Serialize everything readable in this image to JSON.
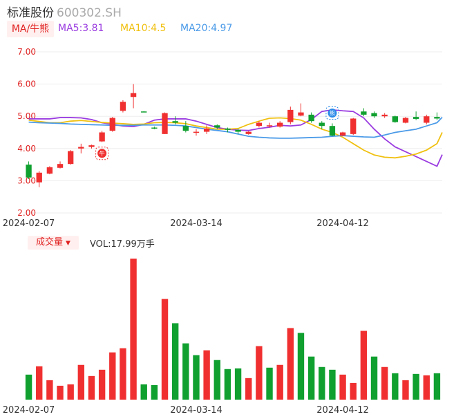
{
  "header": {
    "name": "标准股份",
    "code": "600302.SH"
  },
  "ma_legend": {
    "tag": "MA/牛熊",
    "ma5": "MA5:3.81",
    "ma10": "MA10:4.5",
    "ma20": "MA20:4.97",
    "colors": {
      "ma5": "#9a3be0",
      "ma10": "#f0c010",
      "ma20": "#4a9ae8"
    }
  },
  "volume_legend": {
    "tag": "成交量",
    "value": "VOL:17.99万手"
  },
  "markers": {
    "bull": "牛",
    "bear": "熊"
  },
  "colors": {
    "up": "#f03030",
    "down": "#10a030",
    "grid": "#eeeeee"
  },
  "chart_data": [
    {
      "type": "candlestick",
      "ylim": [
        2.0,
        7.0
      ],
      "yticks": [
        "7.00",
        "6.00",
        "5.00",
        "4.00",
        "3.00",
        "2.00"
      ],
      "xtick_labels": [
        {
          "index": 0,
          "label": "2024-02-07"
        },
        {
          "index": 16,
          "label": "2024-03-14"
        },
        {
          "index": 30,
          "label": "2024-04-12"
        }
      ],
      "candles": [
        {
          "o": 3.5,
          "c": 3.1,
          "h": 3.6,
          "l": 3.05
        },
        {
          "o": 2.95,
          "c": 3.25,
          "h": 3.3,
          "l": 2.8
        },
        {
          "o": 3.22,
          "c": 3.42,
          "h": 3.45,
          "l": 3.2
        },
        {
          "o": 3.4,
          "c": 3.52,
          "h": 3.6,
          "l": 3.38
        },
        {
          "o": 3.52,
          "c": 3.92,
          "h": 3.95,
          "l": 3.5
        },
        {
          "o": 4.0,
          "c": 4.05,
          "h": 4.15,
          "l": 3.85
        },
        {
          "o": 4.05,
          "c": 4.1,
          "h": 4.12,
          "l": 4.0
        },
        {
          "o": 4.22,
          "c": 4.5,
          "h": 4.55,
          "l": 4.2
        },
        {
          "o": 4.55,
          "c": 4.95,
          "h": 4.98,
          "l": 4.52
        },
        {
          "o": 5.17,
          "c": 5.45,
          "h": 5.5,
          "l": 5.12
        },
        {
          "o": 5.6,
          "c": 5.72,
          "h": 6.0,
          "l": 5.25
        },
        {
          "o": 5.15,
          "c": 5.14,
          "h": 5.16,
          "l": 5.13
        },
        {
          "o": 4.65,
          "c": 4.62,
          "h": 4.68,
          "l": 4.6
        },
        {
          "o": 4.45,
          "c": 5.1,
          "h": 5.12,
          "l": 4.45
        },
        {
          "o": 4.85,
          "c": 4.8,
          "h": 5.0,
          "l": 4.75
        },
        {
          "o": 4.7,
          "c": 4.55,
          "h": 4.85,
          "l": 4.5
        },
        {
          "o": 4.52,
          "c": 4.52,
          "h": 4.6,
          "l": 4.4
        },
        {
          "o": 4.52,
          "c": 4.62,
          "h": 4.72,
          "l": 4.45
        },
        {
          "o": 4.72,
          "c": 4.65,
          "h": 4.75,
          "l": 4.6
        },
        {
          "o": 4.62,
          "c": 4.58,
          "h": 4.65,
          "l": 4.5
        },
        {
          "o": 4.58,
          "c": 4.52,
          "h": 4.62,
          "l": 4.45
        },
        {
          "o": 4.45,
          "c": 4.52,
          "h": 4.54,
          "l": 4.43
        },
        {
          "o": 4.7,
          "c": 4.8,
          "h": 4.85,
          "l": 4.65
        },
        {
          "o": 4.72,
          "c": 4.72,
          "h": 4.8,
          "l": 4.65
        },
        {
          "o": 4.68,
          "c": 4.8,
          "h": 4.85,
          "l": 4.65
        },
        {
          "o": 4.82,
          "c": 5.2,
          "h": 5.3,
          "l": 4.75
        },
        {
          "o": 5.02,
          "c": 5.12,
          "h": 5.4,
          "l": 5.0
        },
        {
          "o": 5.05,
          "c": 4.85,
          "h": 5.12,
          "l": 4.8
        },
        {
          "o": 4.8,
          "c": 4.7,
          "h": 4.85,
          "l": 4.6
        },
        {
          "o": 4.7,
          "c": 4.4,
          "h": 4.78,
          "l": 4.38
        },
        {
          "o": 4.4,
          "c": 4.5,
          "h": 4.52,
          "l": 4.38
        },
        {
          "o": 4.45,
          "c": 4.93,
          "h": 4.95,
          "l": 4.42
        },
        {
          "o": 5.15,
          "c": 5.05,
          "h": 5.25,
          "l": 5.0
        },
        {
          "o": 5.1,
          "c": 5.0,
          "h": 5.15,
          "l": 4.95
        },
        {
          "o": 5.0,
          "c": 5.05,
          "h": 5.1,
          "l": 4.95
        },
        {
          "o": 5.0,
          "c": 4.82,
          "h": 5.02,
          "l": 4.8
        },
        {
          "o": 4.8,
          "c": 4.95,
          "h": 4.98,
          "l": 4.78
        },
        {
          "o": 4.98,
          "c": 4.92,
          "h": 5.15,
          "l": 4.88
        },
        {
          "o": 4.8,
          "c": 5.0,
          "h": 5.05,
          "l": 4.75
        },
        {
          "o": 4.98,
          "c": 4.93,
          "h": 5.12,
          "l": 4.88
        }
      ],
      "series": [
        {
          "name": "MA5",
          "color": "#9a3be0",
          "values": [
            4.92,
            4.92,
            4.92,
            4.96,
            4.96,
            4.95,
            4.9,
            4.8,
            4.75,
            4.7,
            4.68,
            4.75,
            4.88,
            4.92,
            4.92,
            4.92,
            4.85,
            4.75,
            4.65,
            4.6,
            4.57,
            4.56,
            4.62,
            4.66,
            4.72,
            4.7,
            4.73,
            4.9,
            5.15,
            5.2,
            5.17,
            5.15,
            4.95,
            4.6,
            4.3,
            4.05,
            3.9,
            3.75,
            3.6,
            3.45
          ]
        },
        {
          "name": "MA10",
          "color": "#f0c010",
          "values": [
            4.88,
            4.84,
            4.8,
            4.8,
            4.85,
            4.87,
            4.84,
            4.81,
            4.79,
            4.77,
            4.75,
            4.76,
            4.8,
            4.81,
            4.8,
            4.77,
            4.7,
            4.65,
            4.6,
            4.6,
            4.62,
            4.75,
            4.85,
            4.94,
            4.95,
            4.93,
            4.88,
            4.75,
            4.6,
            4.5,
            4.35,
            4.15,
            3.95,
            3.8,
            3.73,
            3.71,
            3.76,
            3.83,
            3.95,
            4.15
          ]
        },
        {
          "name": "MA20",
          "color": "#4a9ae8",
          "values": [
            4.82,
            4.8,
            4.79,
            4.78,
            4.76,
            4.75,
            4.74,
            4.73,
            4.72,
            4.72,
            4.72,
            4.73,
            4.73,
            4.73,
            4.72,
            4.7,
            4.65,
            4.6,
            4.56,
            4.52,
            4.45,
            4.38,
            4.35,
            4.33,
            4.32,
            4.32,
            4.33,
            4.34,
            4.35,
            4.38,
            4.4,
            4.38,
            4.36,
            4.35,
            4.42,
            4.5,
            4.55,
            4.6,
            4.7,
            4.8
          ]
        }
      ],
      "extra_line_points": [
        {
          "name": "MA5",
          "index": 39.5,
          "value": 3.81
        },
        {
          "name": "MA10",
          "index": 39.5,
          "value": 4.5
        },
        {
          "name": "MA20",
          "index": 39.5,
          "value": 4.97
        }
      ],
      "signals": [
        {
          "type": "bull",
          "index": 7,
          "value": 3.85
        },
        {
          "type": "bear",
          "index": 29,
          "value": 5.1
        }
      ]
    },
    {
      "type": "bar",
      "title": "成交量",
      "xtick_labels": [
        {
          "index": 0,
          "label": "2024-02-07"
        },
        {
          "index": 16,
          "label": "2024-03-14"
        },
        {
          "index": 30,
          "label": "2024-04-12"
        }
      ],
      "values": [
        36,
        48,
        28,
        20,
        22,
        50,
        34,
        43,
        68,
        74,
        203,
        22,
        21,
        145,
        110,
        81,
        64,
        71,
        57,
        44,
        45,
        31,
        77,
        46,
        50,
        103,
        96,
        62,
        47,
        43,
        36,
        24,
        99,
        62,
        47,
        38,
        28,
        37,
        35,
        38
      ],
      "directions": [
        "down",
        "up",
        "up",
        "up",
        "up",
        "up",
        "up",
        "up",
        "up",
        "up",
        "up",
        "down",
        "down",
        "up",
        "down",
        "down",
        "down",
        "up",
        "down",
        "down",
        "down",
        "up",
        "up",
        "down",
        "up",
        "up",
        "down",
        "down",
        "down",
        "down",
        "up",
        "up",
        "up",
        "down",
        "up",
        "down",
        "up",
        "down",
        "up",
        "down"
      ]
    }
  ]
}
